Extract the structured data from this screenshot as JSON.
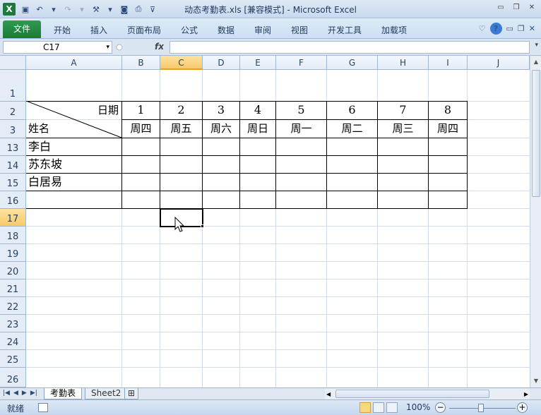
{
  "window": {
    "title": "动态考勤表.xls  [兼容模式]  -  Microsoft Excel",
    "app_icon": "X"
  },
  "ribbon": {
    "file_tab": "文件",
    "tabs": [
      "开始",
      "插入",
      "页面布局",
      "公式",
      "数据",
      "审阅",
      "视图",
      "开发工具",
      "加载项"
    ]
  },
  "formula_bar": {
    "name_box": "C17",
    "fx_label": "fx",
    "formula": ""
  },
  "columns": [
    "A",
    "B",
    "C",
    "D",
    "E",
    "F",
    "G",
    "H",
    "I",
    "J"
  ],
  "selected_column": "C",
  "rows": [
    "1",
    "2",
    "3",
    "13",
    "14",
    "15",
    "16",
    "17",
    "18",
    "19",
    "20",
    "21",
    "22",
    "23",
    "24",
    "25",
    "26"
  ],
  "selected_row": "17",
  "table": {
    "header_date_label": "日期",
    "header_name_label": "姓名",
    "days": [
      "1",
      "2",
      "3",
      "4",
      "5",
      "6",
      "7",
      "8"
    ],
    "weekdays": [
      "周四",
      "周五",
      "周六",
      "周日",
      "周一",
      "周二",
      "周三",
      "周四"
    ],
    "names": [
      "李白",
      "苏东坡",
      "白居易",
      ""
    ]
  },
  "sheets": {
    "tabs": [
      "考勤表",
      "Sheet2"
    ],
    "active_index": 0
  },
  "status": {
    "mode": "就绪",
    "zoom": "100%"
  }
}
